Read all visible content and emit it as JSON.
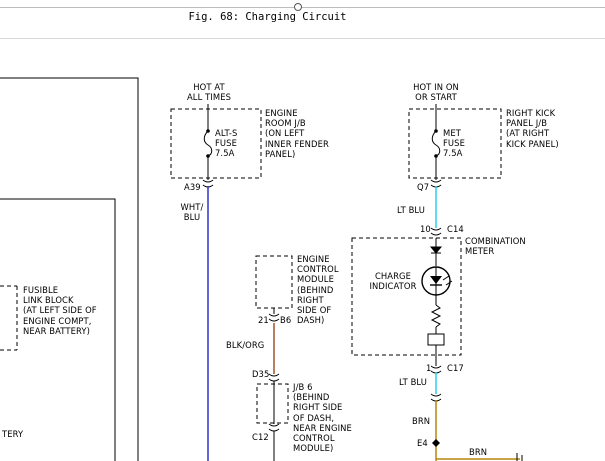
{
  "figure": {
    "title": "Fig. 68: Charging Circuit"
  },
  "fuse_alts": {
    "power_text": [
      "HOT AT",
      "ALL TIMES"
    ],
    "fuse_text": [
      "ALT-S",
      "FUSE",
      "7.5A"
    ],
    "location_text": [
      "ENGINE",
      "ROOM J/B",
      "(ON LEFT",
      "INNER FENDER",
      "PANEL)"
    ],
    "connector": "A39"
  },
  "fuse_met": {
    "power_text": [
      "HOT IN ON",
      "OR START"
    ],
    "fuse_text": [
      "MET",
      "FUSE",
      "7.5A"
    ],
    "location_text": [
      "RIGHT KICK",
      "PANEL J/B",
      "(AT RIGHT",
      "KICK PANEL)"
    ],
    "connector": "Q7"
  },
  "wire_wht_blu": {
    "text": [
      "WHT/",
      "BLU"
    ],
    "color": "#3333cc"
  },
  "wire_lt_blu_top": {
    "text": "LT BLU",
    "color": "#33ccee"
  },
  "combination_meter": {
    "title": [
      "COMBINATION",
      "METER"
    ],
    "pin_top": "10",
    "connector_top": "C14",
    "indicator_text": [
      "CHARGE",
      "INDICATOR"
    ],
    "pin_bottom": "1",
    "connector_bottom": "C17"
  },
  "wire_lt_blu_bottom": {
    "text": "LT BLU",
    "color": "#33ccee"
  },
  "wire_brn": {
    "text": "BRN",
    "color": "#b8860b"
  },
  "splice": {
    "label": "E4"
  },
  "wire_brn_horizontal": {
    "text": "BRN"
  },
  "ecm": {
    "title": [
      "ENGINE",
      "CONTROL",
      "MODULE",
      "(BEHIND",
      "RIGHT",
      "SIDE OF",
      "DASH)"
    ],
    "pin": "21",
    "connector": "B6"
  },
  "wire_blk_org": {
    "text": "BLK/ORG",
    "color": "#a0522d"
  },
  "jb6": {
    "connector_top": "D35",
    "title": [
      "J/B 6",
      "(BEHIND",
      "RIGHT SIDE",
      "OF DASH,",
      "NEAR ENGINE",
      "CONTROL",
      "MODULE)"
    ],
    "connector_bottom": "C12"
  },
  "fusible_link": {
    "title": [
      "FUSIBLE",
      "LINK BLOCK",
      "(AT LEFT SIDE OF",
      "ENGINE COMPT,",
      "NEAR BATTERY)"
    ]
  },
  "battery": {
    "label_fragment": "TERY"
  }
}
